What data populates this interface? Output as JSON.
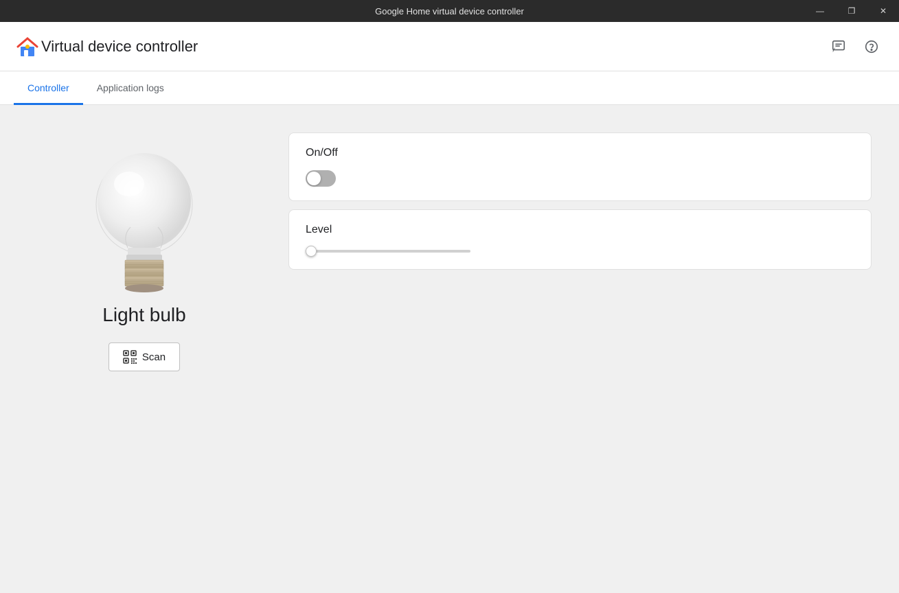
{
  "window": {
    "title": "Google Home virtual device controller",
    "controls": {
      "minimize": "—",
      "maximize": "❐",
      "close": "✕"
    }
  },
  "header": {
    "app_title": "Virtual device controller",
    "logo_alt": "Google Home logo",
    "icons": {
      "feedback": "feedback-icon",
      "help": "help-icon"
    }
  },
  "tabs": [
    {
      "id": "controller",
      "label": "Controller",
      "active": true
    },
    {
      "id": "application-logs",
      "label": "Application logs",
      "active": false
    }
  ],
  "left_panel": {
    "device_name": "Light bulb",
    "scan_button_label": "Scan"
  },
  "controls": {
    "on_off": {
      "label": "On/Off",
      "enabled": false
    },
    "level": {
      "label": "Level",
      "value": 0,
      "min": 0,
      "max": 100
    }
  },
  "colors": {
    "accent_blue": "#1a73e8",
    "toggle_off": "#b0b0b0",
    "card_bg": "#ffffff",
    "bg": "#f0f0f0"
  }
}
